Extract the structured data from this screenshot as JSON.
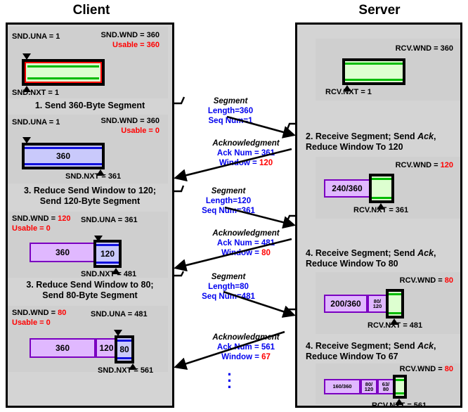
{
  "headers": {
    "client": "Client",
    "server": "Server"
  },
  "colors": {
    "panel_border": "#000000",
    "panel_bg": "#d4d4d4",
    "block_bg": "#cfcfcf",
    "usable_window_fill": "#ddffd0",
    "usable_window_stripe": "#00bb00",
    "usable_window_border": "#ff0000",
    "sending_fill": "#c9c9fb",
    "sending_stripe": "#1111dd",
    "acked_fill": "#e0b8ff",
    "acked_border": "#7a00c0",
    "value_highlight": "#ff0000",
    "message_text": "#0000ee"
  },
  "client": {
    "steps": [
      {
        "caption": "1. Send 360-Byte Segment",
        "snd_una": "SND.UNA = 1",
        "snd_nxt": "SND.NXT = 1",
        "snd_wnd": "SND.WND = 360",
        "usable": "Usable = 360",
        "boxes": []
      },
      {
        "caption_line1": "3. Reduce Send Window to 120;",
        "caption_line2": "Send 120-Byte Segment",
        "snd_una": "SND.UNA = 1",
        "snd_nxt": "SND.NXT = 361",
        "snd_wnd": "SND.WND = 360",
        "usable": "Usable = 0",
        "sending_label": "360"
      },
      {
        "caption_line1": "3. Reduce Send Window to 80;",
        "caption_line2": "Send 80-Byte Segment",
        "snd_una": "SND.UNA = 361",
        "snd_nxt": "SND.NXT = 481",
        "snd_wnd": "SND.WND = 120",
        "usable": "Usable = 0",
        "acked_label": "360",
        "sending_label": "120"
      },
      {
        "snd_una": "SND.UNA = 481",
        "snd_nxt": "SND.NXT = 561",
        "snd_wnd": "SND.WND = 80",
        "usable": "Usable = 0",
        "acked_label_1": "360",
        "acked_label_2": "120",
        "sending_label": "80"
      }
    ]
  },
  "server": {
    "steps": [
      {
        "rcv_wnd": "RCV.WND = 360",
        "rcv_nxt": "RCV.NXT = 1"
      },
      {
        "caption_line1": "2. Receive Segment; Send ",
        "caption_ack": "Ack",
        "caption_line1_end": ",",
        "caption_line2": "Reduce Window To 120",
        "rcv_wnd_label": "RCV.WND = ",
        "rcv_wnd_value": "120",
        "rcv_nxt": "RCV.NXT = 361",
        "received_label": "240/360"
      },
      {
        "caption_line1": "4. Receive Segment; Send ",
        "caption_ack": "Ack",
        "caption_line1_end": ",",
        "caption_line2": "Reduce Window To 80",
        "rcv_wnd_label": "RCV.WND = ",
        "rcv_wnd_value": "80",
        "rcv_nxt": "RCV.NXT = 481",
        "received_label_1": "200/360",
        "received_label_2a": "80/",
        "received_label_2b": "120"
      },
      {
        "caption_line1": "4. Receive Segment; Send ",
        "caption_ack": "Ack",
        "caption_line1_end": ",",
        "caption_line2": "Reduce Window To 67",
        "rcv_wnd_label": "RCV.WND = ",
        "rcv_wnd_value": "80",
        "rcv_nxt": "RCV.NXT = 561",
        "received_label_1": "160/360",
        "received_label_2a": "80/",
        "received_label_2b": "120",
        "received_label_3a": "63/",
        "received_label_3b": "80"
      }
    ]
  },
  "messages": [
    {
      "kind": "segment",
      "header": "Segment",
      "line1": "Length=360",
      "line2": "Seq Num=1"
    },
    {
      "kind": "acknowledgment",
      "header": "Acknowledgment",
      "line1": "Ack Num = 361",
      "line2_label": "Window = ",
      "line2_value": "120"
    },
    {
      "kind": "segment",
      "header": "Segment",
      "line1": "Length=120",
      "line2": "Seq Num=361"
    },
    {
      "kind": "acknowledgment",
      "header": "Acknowledgment",
      "line1": "Ack Num = 481",
      "line2_label": "Window = ",
      "line2_value": "80"
    },
    {
      "kind": "segment",
      "header": "Segment",
      "line1": "Length=80",
      "line2": "Seq Num=481"
    },
    {
      "kind": "acknowledgment",
      "header": "Acknowledgment",
      "line1": "Ack Num = 561",
      "line2_label": "Window = ",
      "line2_value": "67"
    }
  ],
  "continuation": "⋮"
}
